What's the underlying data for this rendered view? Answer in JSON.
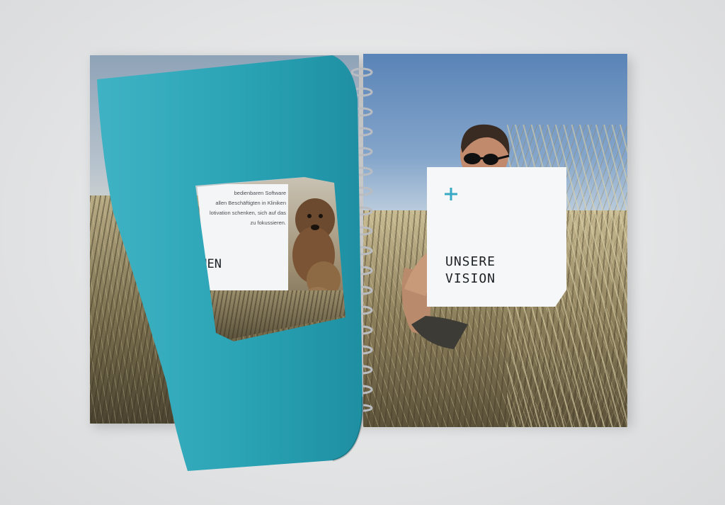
{
  "scene": {
    "description_role": "photo",
    "colors": {
      "background": "#e4e5e6",
      "teal_page": "#2aa3b5",
      "accent_plus": "#37a9c4",
      "card": "#f6f7f8",
      "heading_text": "#1c2126"
    }
  },
  "right_page": {
    "card_icon": "plus-icon",
    "card_title": "UNSERE\nVISION"
  },
  "left_window": {
    "text_snippet": "bedienbaren Software\nallen Beschäftigten in Kliniken\nlotivation schenken, sich auf das\nzu fokussieren.",
    "partial_heading": "CHEN\nEN"
  }
}
